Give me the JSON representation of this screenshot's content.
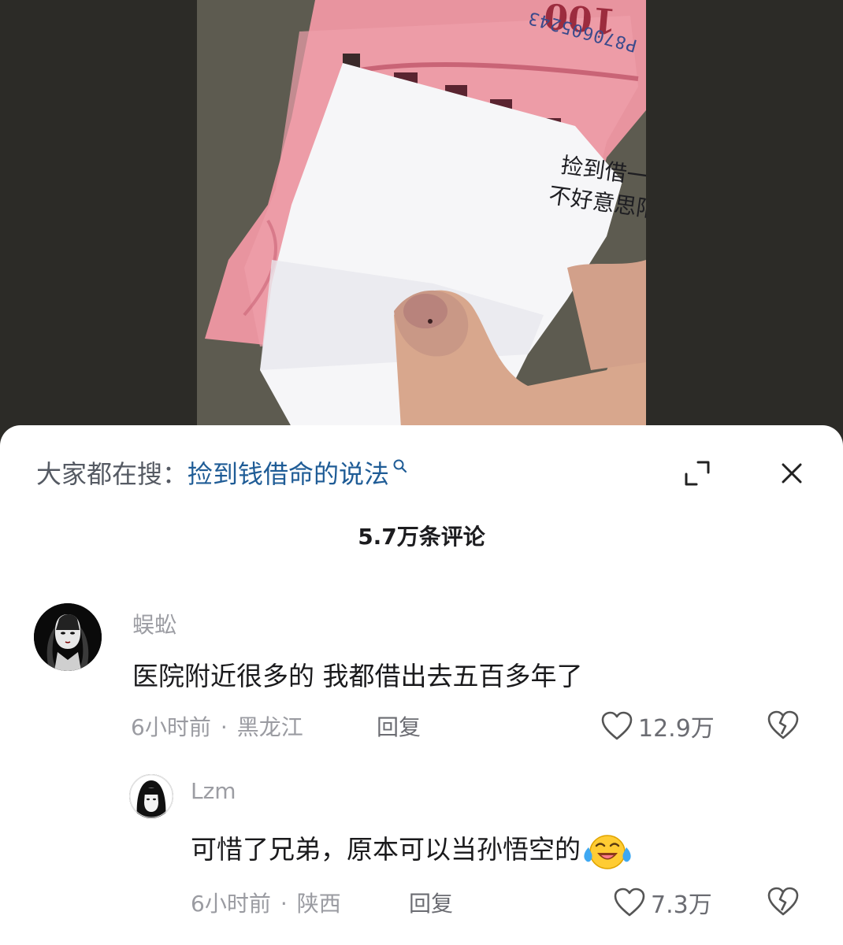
{
  "video": {
    "serial_number": "P870605243",
    "denomination": "100",
    "note_lines": [
      "捡到借一年寿命",
      "不好意思陌生人",
      "陌生人"
    ]
  },
  "search": {
    "prefix": "大家都在搜：",
    "query": "捡到钱借命的说法"
  },
  "comments_header": {
    "count_label": "5.7万条评论"
  },
  "comments": [
    {
      "username": "蜈蚣",
      "text": "医院附近很多的 我都借出去五百多年了",
      "time": "6小时前",
      "location": "黑龙江",
      "reply_label": "回复",
      "likes": "12.9万",
      "replies": [
        {
          "username": "Lzm",
          "text": "可惜了兄弟，原本可以当孙悟空的",
          "emoji": "crying-laughing-emoji",
          "time": "6小时前",
          "location": "陕西",
          "reply_label": "回复",
          "likes": "7.3万"
        }
      ]
    }
  ],
  "icons": [
    "search-icon",
    "expand-icon",
    "close-icon",
    "heart-icon",
    "broken-heart-icon"
  ],
  "colors": {
    "search_query": "#1f5c96",
    "banknote_pink": "#e48a99",
    "sheet_bg": "#ffffff"
  }
}
